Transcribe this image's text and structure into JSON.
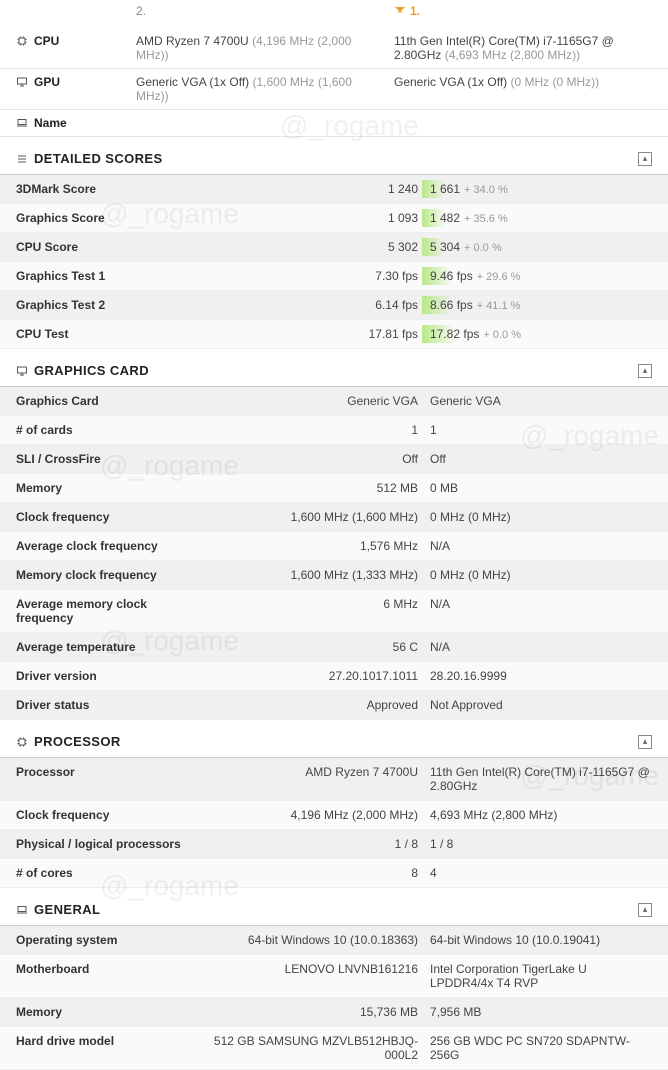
{
  "rank": {
    "col1": "2.",
    "col2_label": "1."
  },
  "summary": {
    "cpu_label": "CPU",
    "gpu_label": "GPU",
    "name_label": "Name",
    "cpu1_main": "AMD Ryzen 7 4700U",
    "cpu1_sub": "(4,196 MHz (2,000 MHz))",
    "cpu2_main": "11th Gen Intel(R) Core(TM) i7-1165G7 @ 2.80GHz",
    "cpu2_sub": "(4,693 MHz (2,800 MHz))",
    "gpu1_main": "Generic VGA (1x Off)",
    "gpu1_sub": "(1,600 MHz (1,600 MHz))",
    "gpu2_main": "Generic VGA (1x Off)",
    "gpu2_sub": "(0 MHz (0 MHz))"
  },
  "detailed": {
    "title": "DETAILED SCORES",
    "rows": [
      {
        "label": "3DMark Score",
        "v1": "1 240",
        "v2": "1 661",
        "d": "+ 34.0 %"
      },
      {
        "label": "Graphics Score",
        "v1": "1 093",
        "v2": "1 482",
        "d": "+ 35.6 %"
      },
      {
        "label": "CPU Score",
        "v1": "5 302",
        "v2": "5 304",
        "d": "+ 0.0 %"
      },
      {
        "label": "Graphics Test 1",
        "v1": "7.30 fps",
        "v2": "9.46 fps",
        "d": "+ 29.6 %"
      },
      {
        "label": "Graphics Test 2",
        "v1": "6.14 fps",
        "v2": "8.66 fps",
        "d": "+ 41.1 %"
      },
      {
        "label": "CPU Test",
        "v1": "17.81 fps",
        "v2": "17.82 fps",
        "d": "+ 0.0 %"
      }
    ]
  },
  "gpu": {
    "title": "GRAPHICS CARD",
    "rows": [
      {
        "label": "Graphics Card",
        "v1": "Generic VGA",
        "v2": "Generic VGA"
      },
      {
        "label": "# of cards",
        "v1": "1",
        "v2": "1"
      },
      {
        "label": "SLI / CrossFire",
        "v1": "Off",
        "v2": "Off"
      },
      {
        "label": "Memory",
        "v1": "512 MB",
        "v2": "0 MB"
      },
      {
        "label": "Clock frequency",
        "v1": "1,600 MHz (1,600 MHz)",
        "v2": "0 MHz (0 MHz)"
      },
      {
        "label": "Average clock frequency",
        "v1": "1,576 MHz",
        "v2": "N/A"
      },
      {
        "label": "Memory clock frequency",
        "v1": "1,600 MHz (1,333 MHz)",
        "v2": "0 MHz (0 MHz)"
      },
      {
        "label": "Average memory clock frequency",
        "v1": "6 MHz",
        "v2": "N/A"
      },
      {
        "label": "Average temperature",
        "v1": "56 C",
        "v2": "N/A"
      },
      {
        "label": "Driver version",
        "v1": "27.20.1017.1011",
        "v2": "28.20.16.9999"
      },
      {
        "label": "Driver status",
        "v1": "Approved",
        "v2": "Not Approved"
      }
    ]
  },
  "cpu": {
    "title": "PROCESSOR",
    "rows": [
      {
        "label": "Processor",
        "v1": "AMD Ryzen 7 4700U",
        "v2": "11th Gen Intel(R) Core(TM) i7-1165G7 @ 2.80GHz"
      },
      {
        "label": "Clock frequency",
        "v1": "4,196 MHz (2,000 MHz)",
        "v2": "4,693 MHz (2,800 MHz)"
      },
      {
        "label": "Physical / logical processors",
        "v1": "1 / 8",
        "v2": "1 / 8"
      },
      {
        "label": "# of cores",
        "v1": "8",
        "v2": "4"
      }
    ]
  },
  "general": {
    "title": "GENERAL",
    "rows": [
      {
        "label": "Operating system",
        "v1": "64-bit Windows 10 (10.0.18363)",
        "v2": "64-bit Windows 10 (10.0.19041)"
      },
      {
        "label": "Motherboard",
        "v1": "LENOVO LNVNB161216",
        "v2": "Intel Corporation TigerLake U LPDDR4/4x T4 RVP"
      },
      {
        "label": "Memory",
        "v1": "15,736 MB",
        "v2": "7,956 MB"
      },
      {
        "label": "Hard drive model",
        "v1": "512 GB SAMSUNG MZVLB512HBJQ-000L2",
        "v2": "256 GB WDC PC SN720 SDAPNTW-256G"
      }
    ]
  },
  "watermark": "@_rogame"
}
